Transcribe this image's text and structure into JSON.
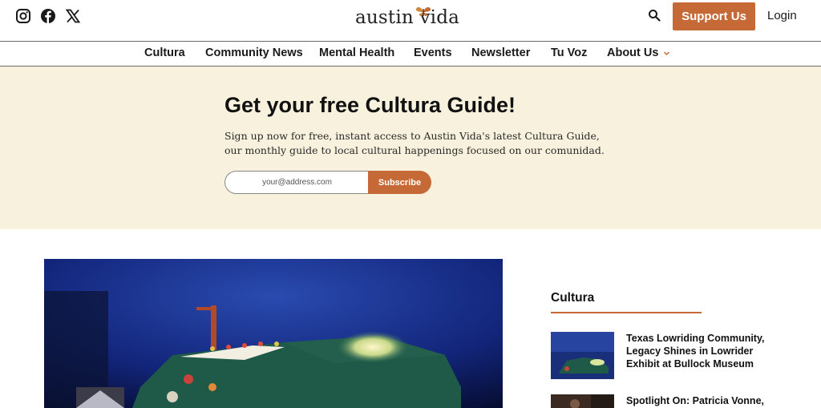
{
  "header": {
    "social": [
      {
        "icon": "instagram-icon"
      },
      {
        "icon": "facebook-icon"
      },
      {
        "icon": "x-twitter-icon"
      }
    ],
    "logo_text": "austin vida",
    "support_label": "Support Us",
    "login_label": "Login",
    "search_icon": "search-icon"
  },
  "nav": {
    "items": [
      {
        "label": "Cultura"
      },
      {
        "label": "Community News"
      },
      {
        "label": "Mental Health"
      },
      {
        "label": "Events"
      },
      {
        "label": "Newsletter"
      },
      {
        "label": "Tu Voz"
      },
      {
        "label": "About Us"
      }
    ]
  },
  "newsletter": {
    "title": "Get your free Cultura Guide!",
    "text": "Sign up now for free, instant access to Austin Vida's latest Cultura Guide, our monthly guide to local cultural happenings focused on our comunidad.",
    "email_placeholder": "your@address.com",
    "subscribe_label": "Subscribe"
  },
  "sidebar": {
    "heading": "Cultura",
    "stories": [
      {
        "title": "Texas Lowriding Community, Legacy Shines in Lowrider Exhibit at Bullock Museum"
      },
      {
        "title": "Spotlight On: Patricia Vonne,"
      }
    ]
  },
  "colors": {
    "accent": "#c56a36",
    "band_bg": "#f7f1dd",
    "text": "#1a1a1a"
  }
}
